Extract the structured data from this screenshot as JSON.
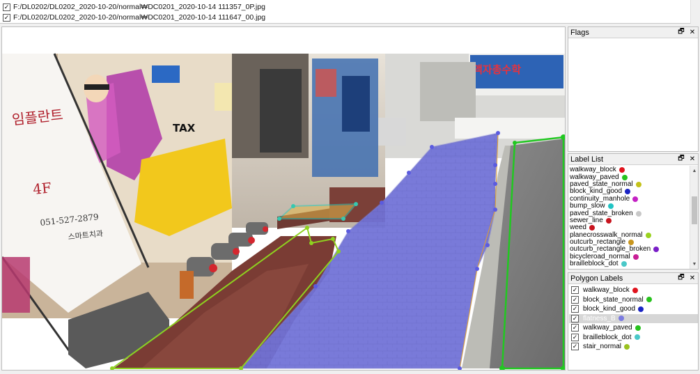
{
  "file_list": [
    {
      "checked": true,
      "path": "F:/DL0202/DL0202_2020-10-20/normal₩DC0201_2020-10-14 111357_0P.jpg"
    },
    {
      "checked": true,
      "path": "F:/DL0202/DL0202_2020-10-20/normal₩DC0201_2020-10-14 111647_00.jpg"
    }
  ],
  "photo_text": {
    "banner_floor": "4F",
    "banner_phone": "051-527-2879",
    "banner_clinic": "스마트치과",
    "banner_korean": "임플란트",
    "taxi": "TAX",
    "sign_right": "액자총수학"
  },
  "docks": {
    "flags": {
      "title": "Flags"
    },
    "label_list": {
      "title": "Label List",
      "items": [
        {
          "label": "walkway_block",
          "color": "#e0141e"
        },
        {
          "label": "walkway_paved",
          "color": "#27c21d"
        },
        {
          "label": "paved_state_normal",
          "color": "#c4c21a"
        },
        {
          "label": "block_kind_good",
          "color": "#1a24c4"
        },
        {
          "label": "continuity_manhole",
          "color": "#c421c4"
        },
        {
          "label": "bump_slow",
          "color": "#21c4c4"
        },
        {
          "label": "paved_state_broken",
          "color": "#c8c8c8"
        },
        {
          "label": "sewer_line",
          "color": "#c8141e"
        },
        {
          "label": "weed",
          "color": "#c8141e"
        },
        {
          "label": "planecrosswalk_normal",
          "color": "#9ad21f"
        },
        {
          "label": "outcurb_rectangle",
          "color": "#c8961e"
        },
        {
          "label": "outcurb_rectangle_broken",
          "color": "#7a1ec8"
        },
        {
          "label": "bicycleroad_normal",
          "color": "#c81e96"
        },
        {
          "label": "brailleblock_dot",
          "color": "#4ac8c8"
        }
      ]
    },
    "polygon_labels": {
      "title": "Polygon Labels",
      "items": [
        {
          "label": "walkway_block",
          "color": "#e0141e",
          "checked": true,
          "selected": false
        },
        {
          "label": "block_state_normal",
          "color": "#27c21d",
          "checked": true,
          "selected": false
        },
        {
          "label": "block_kind_good",
          "color": "#1a24c4",
          "checked": true,
          "selected": false
        },
        {
          "label": "flatness_B",
          "color": "#7b7be0",
          "checked": true,
          "selected": true
        },
        {
          "label": "walkway_paved",
          "color": "#27c21d",
          "checked": true,
          "selected": false
        },
        {
          "label": "brailleblock_dot",
          "color": "#4ac8c8",
          "checked": true,
          "selected": false
        },
        {
          "label": "stair_normal",
          "color": "#9ac21f",
          "checked": true,
          "selected": false
        }
      ]
    }
  },
  "dock_buttons": {
    "float": "🗗",
    "close": "✕"
  },
  "colors": {
    "walkway_block_fill": "#5050ff",
    "walkway_block_edge": "#7070e0",
    "walkway_paved_edge": "#21c821",
    "stair_edge": "#8ed21f",
    "braille_edge": "#36c8b0"
  }
}
